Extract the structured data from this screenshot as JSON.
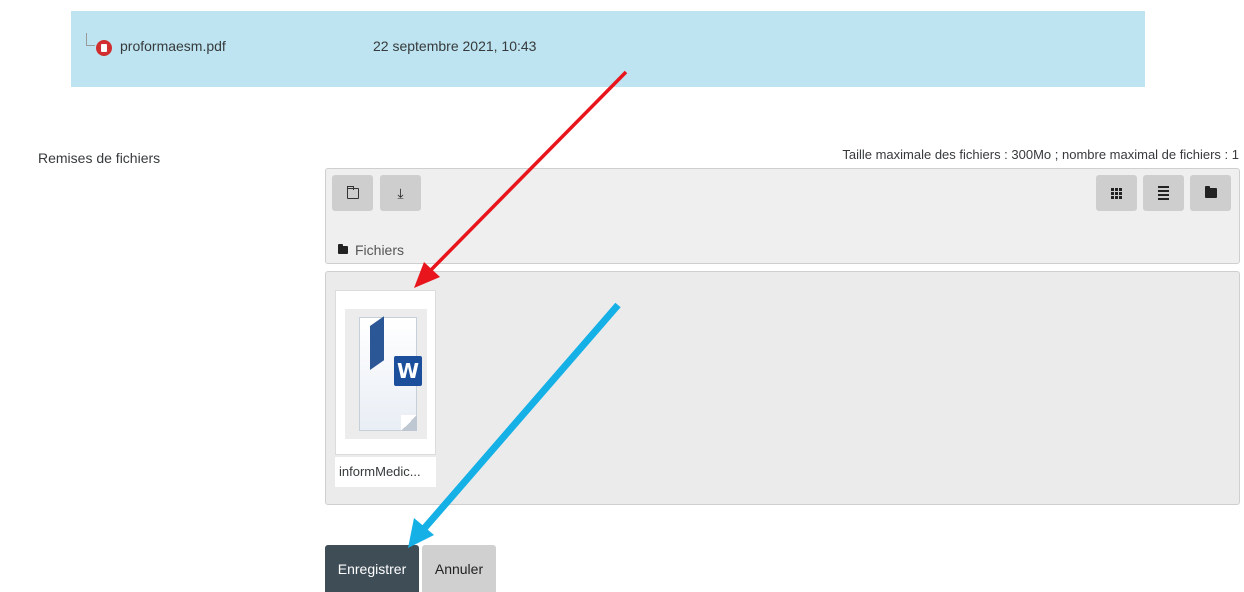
{
  "submitted_file": {
    "name": "proformaesm.pdf",
    "date": "22 septembre 2021, 10:43",
    "icon": "pdf-icon"
  },
  "upload": {
    "label": "Remises de fichiers",
    "limits": "Taille maximale des fichiers : 300Mo ; nombre maximal de fichiers : 1"
  },
  "toolbar": {
    "left_buttons": [
      "new-folder-icon",
      "download-icon"
    ],
    "right_buttons": [
      "grid-view-icon",
      "list-view-icon",
      "tree-view-icon"
    ],
    "breadcrumb": "Fichiers"
  },
  "files": [
    {
      "name": "informMedic...",
      "icon": "word-document-icon"
    }
  ],
  "actions": {
    "save": "Enregistrer",
    "cancel": "Annuler"
  },
  "annotations": {
    "arrow_1_color": "#e8161c",
    "arrow_2_color": "#14b0e6"
  }
}
